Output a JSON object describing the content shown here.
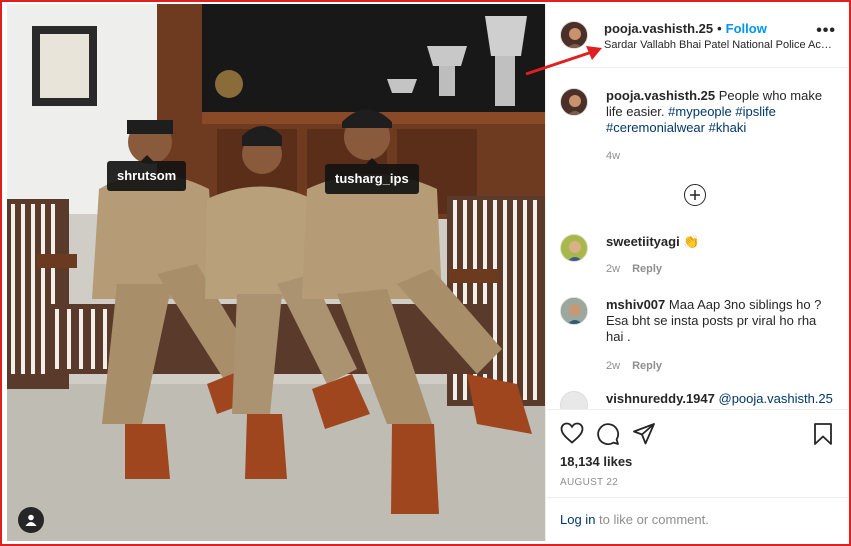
{
  "post": {
    "username": "pooja.vashisth.25",
    "follow_label": "Follow",
    "separator": "•",
    "location": "Sardar Vallabh Bhai Patel National Police Acad...",
    "more_label": "•••"
  },
  "photo_tags": [
    "shrutsom",
    "tusharg_ips"
  ],
  "caption": {
    "username": "pooja.vashisth.25",
    "text": "People who make life easier.",
    "hashtags": [
      "#mypeople",
      "#ipslife",
      "#ceremonialwear",
      "#khaki"
    ],
    "time": "4w"
  },
  "comments": [
    {
      "username": "sweetiityagi",
      "text": "👏",
      "time": "2w",
      "reply_label": "Reply"
    },
    {
      "username": "mshiv007",
      "text": "Maa Aap 3no siblings ho ? Esa bht se insta posts pr viral ho rha hai .",
      "time": "2w",
      "reply_label": "Reply"
    },
    {
      "username": "vishnureddy.1947",
      "text": "@pooja.vashisth.25",
      "time": "",
      "reply_label": ""
    }
  ],
  "likes": "18,134 likes",
  "date": "AUGUST 22",
  "login": {
    "link": "Log in",
    "rest": " to like or comment."
  },
  "colors": {
    "annotation": "#e02020",
    "link": "#0095f6",
    "hashtag": "#00376b",
    "muted": "#8e8e8e"
  },
  "icons": [
    "heart-icon",
    "comment-icon",
    "share-icon",
    "bookmark-icon",
    "plus-circle-icon",
    "user-tag-icon",
    "more-icon",
    "annotation-arrow"
  ]
}
